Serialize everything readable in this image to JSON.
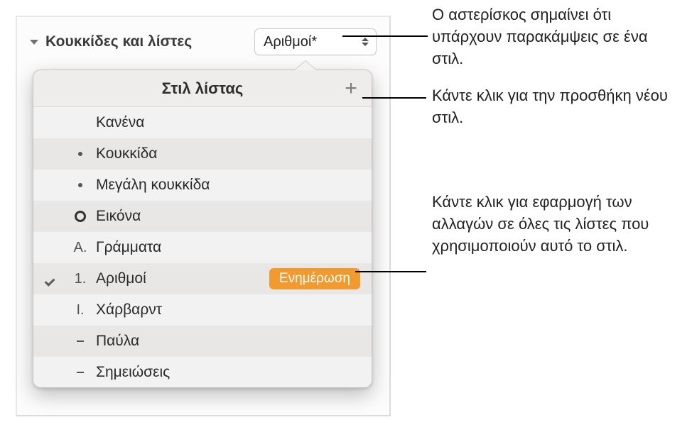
{
  "header": {
    "label": "Κουκκίδες και λίστες"
  },
  "dropdown": {
    "selected_label": "Αριθμοί*"
  },
  "popover": {
    "title": "Στιλ λίστας",
    "add_icon": "+",
    "update_label": "Ενημέρωση",
    "items": [
      {
        "marker": "",
        "markerType": "none",
        "label": "Κανένα",
        "selected": false,
        "hasUpdate": false
      },
      {
        "marker": "",
        "markerType": "dot",
        "label": "Κουκκίδα",
        "selected": false,
        "hasUpdate": false
      },
      {
        "marker": "",
        "markerType": "dot",
        "label": "Μεγάλη κουκκίδα",
        "selected": false,
        "hasUpdate": false
      },
      {
        "marker": "",
        "markerType": "circle",
        "label": "Εικόνα",
        "selected": false,
        "hasUpdate": false
      },
      {
        "marker": "A.",
        "markerType": "text",
        "label": "Γράμματα",
        "selected": false,
        "hasUpdate": false
      },
      {
        "marker": "1.",
        "markerType": "text",
        "label": "Αριθμοί",
        "selected": true,
        "hasUpdate": true
      },
      {
        "marker": "I.",
        "markerType": "text",
        "label": "Χάρβαρντ",
        "selected": false,
        "hasUpdate": false
      },
      {
        "marker": "",
        "markerType": "dash",
        "label": "Παύλα",
        "selected": false,
        "hasUpdate": false
      },
      {
        "marker": "",
        "markerType": "dash",
        "label": "Σημειώσεις",
        "selected": false,
        "hasUpdate": false
      }
    ]
  },
  "callouts": {
    "asterisk": "Ο αστερίσκος σημαίνει ότι υπάρχουν παρακάμψεις σε ένα στιλ.",
    "add": "Κάντε κλικ για την προσθήκη νέου στιλ.",
    "update": "Κάντε κλικ για εφαρμογή των αλλαγών σε όλες τις λίστες που χρησιμοποιούν αυτό το στιλ."
  },
  "colors": {
    "accent_orange": "#f19a2f"
  }
}
